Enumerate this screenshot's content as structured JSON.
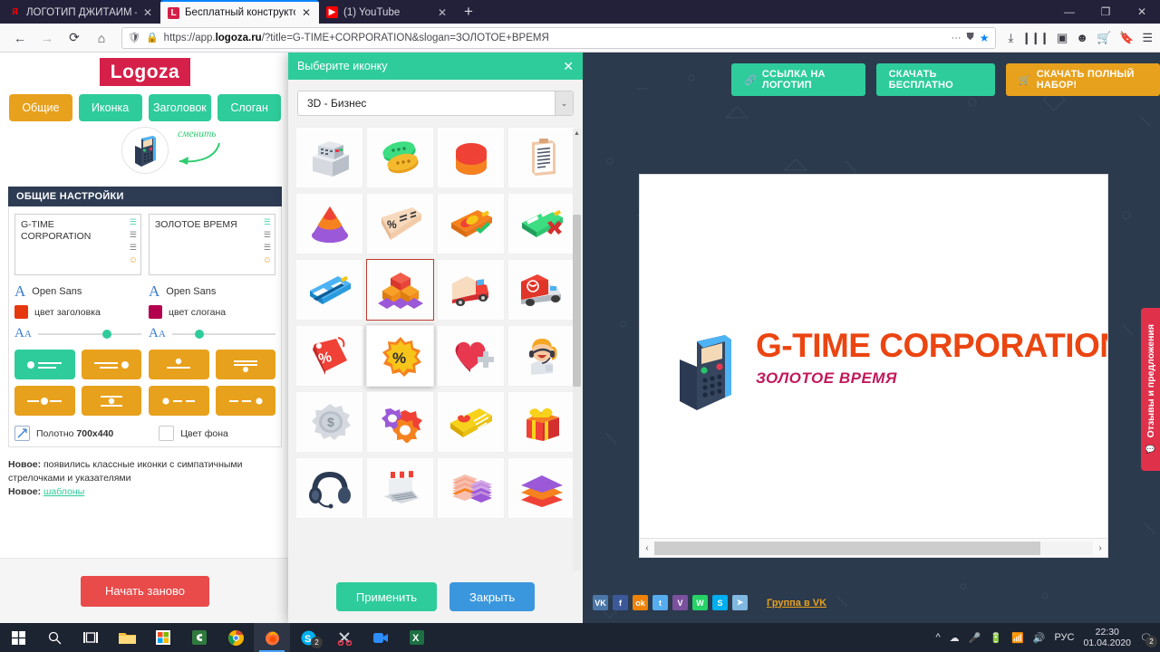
{
  "browser": {
    "tabs": [
      {
        "favicon": "yandex-icon",
        "title": "ЛОГОТИП ДЖИТАЙМ — Янде",
        "close": "✕",
        "active": false
      },
      {
        "favicon": "logoza-icon",
        "title": "Бесплатный конструктор лог",
        "close": "✕",
        "active": true
      },
      {
        "favicon": "youtube-icon",
        "title": "(1) YouTube",
        "close": "✕",
        "active": false
      }
    ],
    "newtab_label": "+",
    "window_controls": {
      "minimize": "—",
      "maximize": "❐",
      "close": "✕"
    },
    "nav": {
      "back": "←",
      "forward": "→",
      "reload": "⟳",
      "home": "⌂"
    },
    "url": {
      "shield": "🛡",
      "lock": "🔒",
      "prefix": "https://app.",
      "domain": "logoza.ru",
      "suffix": "/?title=G-TIME+CORPORATION&slogan=ЗОЛОТОЕ+ВРЕМЯ",
      "dots": "···",
      "pocket": "⛊",
      "star": "★"
    },
    "toolbar_icons": [
      "download-icon",
      "library-icon",
      "sidebar-icon",
      "account-icon",
      "cart-icon",
      "bookmark-icon",
      "menu-icon"
    ]
  },
  "sidebar": {
    "brand": "Logoza",
    "tabs": [
      {
        "label": "Общие",
        "active": true
      },
      {
        "label": "Иконка",
        "active": false
      },
      {
        "label": "Заголовок",
        "active": false
      },
      {
        "label": "Слоган",
        "active": false
      }
    ],
    "change_hint": "сменить",
    "panel_title": "ОБЩИЕ НАСТРОЙКИ",
    "title_field": {
      "value": "G-TIME CORPORATION",
      "font_label": "Open Sans",
      "color_label": "цвет заголовка",
      "color_hex": "#e6380f",
      "align_tools": [
        "align-left-icon",
        "align-center-icon",
        "align-right-icon",
        "emoji-icon"
      ]
    },
    "slogan_field": {
      "value": "ЗОЛОТОЕ ВРЕМЯ",
      "font_label": "Open Sans",
      "color_label": "цвет слогана",
      "color_hex": "#b3004f",
      "align_tools": [
        "align-left-icon",
        "align-center-icon",
        "align-right-icon",
        "emoji-icon"
      ]
    },
    "layouts": [
      {
        "name": "layout-1",
        "selected": true
      },
      {
        "name": "layout-2",
        "selected": false
      },
      {
        "name": "layout-3",
        "selected": false
      },
      {
        "name": "layout-4",
        "selected": false
      },
      {
        "name": "layout-5",
        "selected": false
      },
      {
        "name": "layout-6",
        "selected": false
      },
      {
        "name": "layout-7",
        "selected": false
      },
      {
        "name": "layout-8",
        "selected": false
      }
    ],
    "canvas_label": "Полотно",
    "canvas_size": "700x440",
    "bgcolor_label": "Цвет фона",
    "news": {
      "tag1": "Новое:",
      "text1": " появились классные иконки с симпатичными стрелочками и указателями",
      "tag2": "Новое:",
      "link2": "шаблоны"
    },
    "restart_button": "Начать заново"
  },
  "modal": {
    "title": "Выберите иконку",
    "close": "✕",
    "category": "3D - Бизнес",
    "dropdown_arrow": "⌄",
    "icons": [
      {
        "name": "cash-register-icon",
        "selected": false
      },
      {
        "name": "speech-bubbles-icon",
        "selected": false
      },
      {
        "name": "piggy-coin-icon",
        "selected": false
      },
      {
        "name": "clipboard-icon",
        "selected": false
      },
      {
        "name": "funnel-cone-icon",
        "selected": false
      },
      {
        "name": "discount-voucher-icon",
        "selected": false
      },
      {
        "name": "credit-card-check-icon",
        "selected": false
      },
      {
        "name": "credit-card-cross-icon",
        "selected": false
      },
      {
        "name": "bank-card-icon",
        "selected": false
      },
      {
        "name": "cube-pyramid-icon",
        "selected": true
      },
      {
        "name": "delivery-truck-icon",
        "selected": false
      },
      {
        "name": "cargo-truck-icon",
        "selected": false
      },
      {
        "name": "percent-tag-icon",
        "selected": false
      },
      {
        "name": "percent-badge-icon",
        "selected": false,
        "hover": true
      },
      {
        "name": "heart-plus-icon",
        "selected": false
      },
      {
        "name": "support-agent-icon",
        "selected": false
      },
      {
        "name": "gear-dollar-icon",
        "selected": false
      },
      {
        "name": "gears-icon",
        "selected": false
      },
      {
        "name": "gift-card-icon",
        "selected": false
      },
      {
        "name": "gift-box-icon",
        "selected": false
      },
      {
        "name": "headset-icon",
        "selected": false
      },
      {
        "name": "online-shop-laptop-icon",
        "selected": false
      },
      {
        "name": "paper-stack-icon",
        "selected": false
      },
      {
        "name": "layers-icon",
        "selected": false
      }
    ],
    "apply_button": "Применить",
    "close_button": "Закрыть",
    "cursor": "pointer-hand-cursor"
  },
  "preview": {
    "buttons": [
      {
        "label": "ССЫЛКА НА ЛОГОТИП",
        "icon": "link-icon",
        "style": "green"
      },
      {
        "label": "СКАЧАТЬ БЕСПЛАТНО",
        "icon": "",
        "style": "green"
      },
      {
        "label": "СКАЧАТЬ ПОЛНЫЙ НАБОР!",
        "icon": "cart-icon",
        "style": "orange"
      }
    ],
    "logo": {
      "icon": "pos-terminal-icon",
      "title": "G-TIME CORPORATION",
      "slogan": "ЗОЛОТОЕ ВРЕМЯ",
      "title_color": "#eb4511",
      "slogan_color": "#c2185b"
    },
    "scroll": {
      "left": "‹",
      "right": "›"
    },
    "social": [
      {
        "name": "vk-icon",
        "glyph": "VK",
        "color": "#4a76a8"
      },
      {
        "name": "facebook-icon",
        "glyph": "f",
        "color": "#3b5998"
      },
      {
        "name": "odnoklassniki-icon",
        "glyph": "ok",
        "color": "#ee8208"
      },
      {
        "name": "twitter-icon",
        "glyph": "t",
        "color": "#55acee"
      },
      {
        "name": "viber-icon",
        "glyph": "V",
        "color": "#7b519d"
      },
      {
        "name": "whatsapp-icon",
        "glyph": "W",
        "color": "#25d366"
      },
      {
        "name": "skype-icon",
        "glyph": "S",
        "color": "#00aff0"
      },
      {
        "name": "telegram-icon",
        "glyph": "➤",
        "color": "#7fb8e0"
      }
    ],
    "vk_group_link": "Группа в VK",
    "feedback_tab": "Отзывы и предложения",
    "feedback_icon": "chat-icon"
  },
  "taskbar": {
    "items": [
      {
        "name": "start-button",
        "active": false
      },
      {
        "name": "search-icon",
        "active": false
      },
      {
        "name": "task-view-icon",
        "active": false
      },
      {
        "name": "file-explorer-icon",
        "active": false
      },
      {
        "name": "microsoft-store-icon",
        "active": false
      },
      {
        "name": "camtasia-icon",
        "active": false
      },
      {
        "name": "chrome-icon",
        "active": false
      },
      {
        "name": "firefox-icon",
        "active": true
      },
      {
        "name": "skype-icon",
        "active": false,
        "badge": "2"
      },
      {
        "name": "snipping-tool-icon",
        "active": false
      },
      {
        "name": "zoom-icon",
        "active": false
      },
      {
        "name": "excel-icon",
        "active": false
      }
    ],
    "tray": {
      "chevron": "^",
      "icons": [
        "onedrive-icon",
        "microphone-icon",
        "battery-icon",
        "wifi-icon",
        "volume-icon"
      ],
      "language": "РУС",
      "time": "22:30",
      "date": "01.04.2020",
      "notification_icon": "action-center-icon",
      "notification_badge": "2"
    }
  }
}
